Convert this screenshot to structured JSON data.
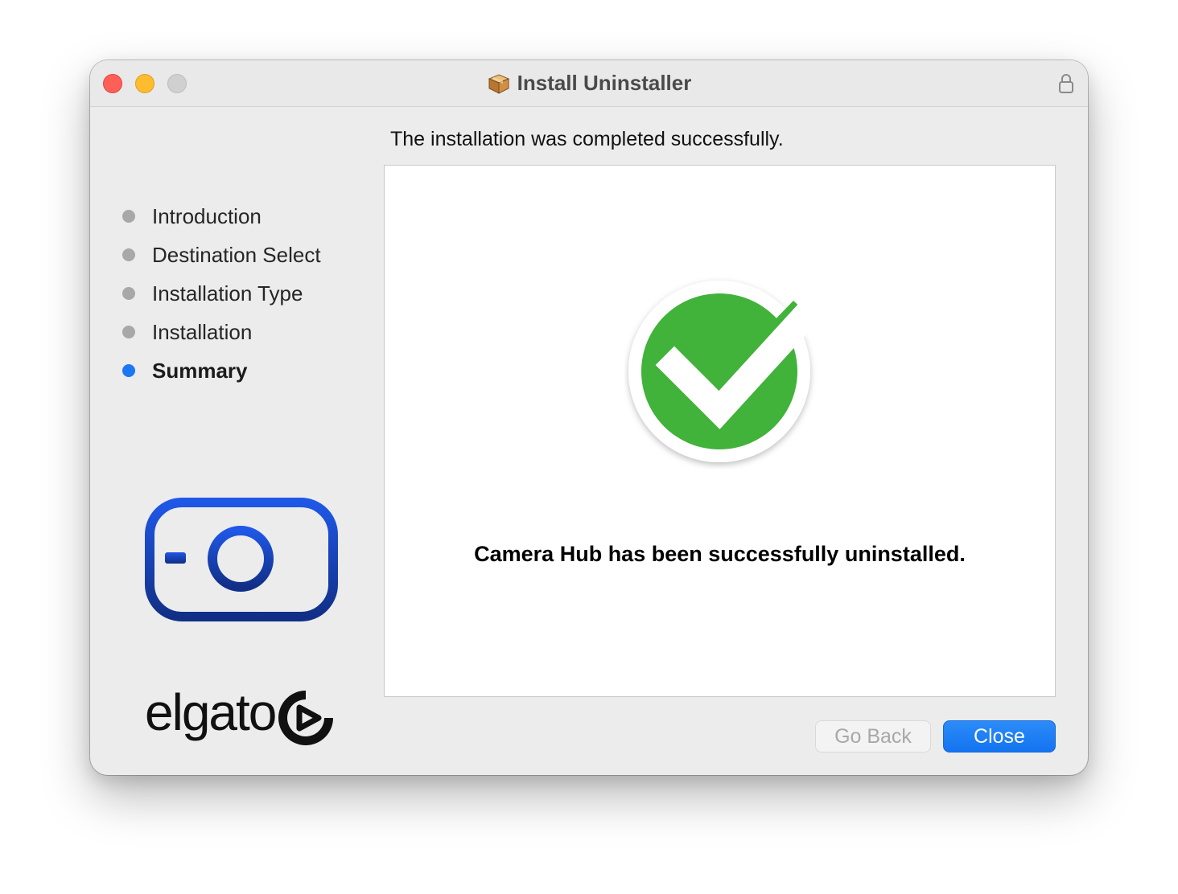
{
  "window": {
    "title": "Install Uninstaller"
  },
  "heading": "The installation was completed successfully.",
  "steps": [
    {
      "label": "Introduction",
      "active": false
    },
    {
      "label": "Destination Select",
      "active": false
    },
    {
      "label": "Installation Type",
      "active": false
    },
    {
      "label": "Installation",
      "active": false
    },
    {
      "label": "Summary",
      "active": true
    }
  ],
  "content": {
    "message": "Camera Hub has been successfully uninstalled.",
    "icon": "success-checkmark-icon"
  },
  "branding": {
    "logo_text": "elgato",
    "camera_icon": "camera-hub-logo-icon"
  },
  "buttons": {
    "back_label": "Go Back",
    "back_enabled": false,
    "close_label": "Close"
  },
  "colors": {
    "accent": "#1a78f2",
    "success": "#41b23a",
    "camera_logo": "#1c4fd6"
  }
}
